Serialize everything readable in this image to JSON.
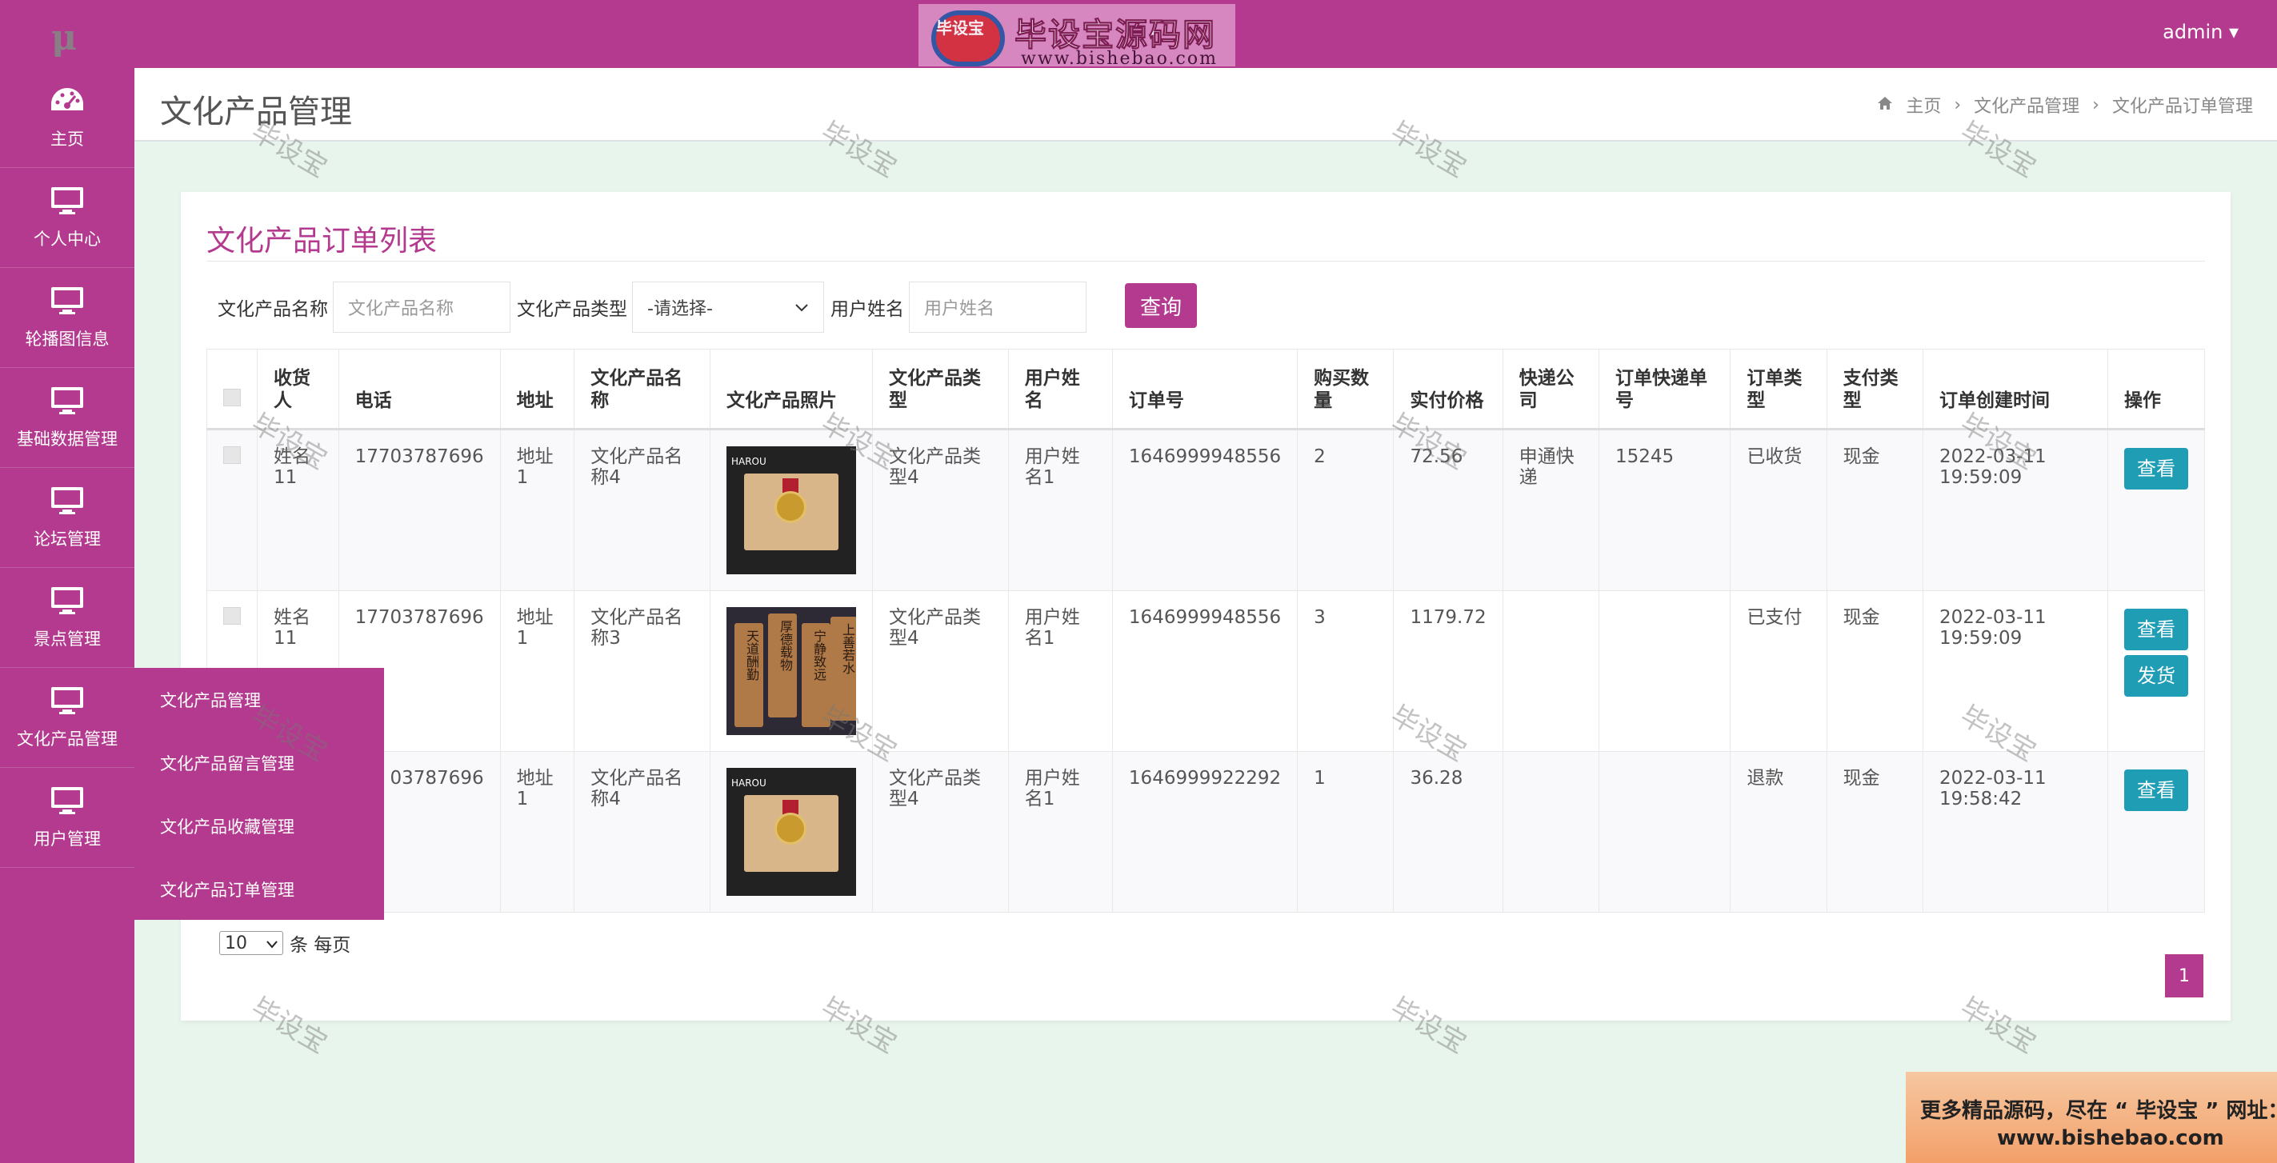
{
  "topbar": {
    "logo": "μ",
    "brand_badge": "毕设宝",
    "brand_title": "毕设宝源码网",
    "brand_url": "www.bishebao.com",
    "user": "admin ▾"
  },
  "sidebar": {
    "items": [
      {
        "label": "主页",
        "icon": "dashboard-icon"
      },
      {
        "label": "个人中心",
        "icon": "monitor-icon"
      },
      {
        "label": "轮播图信息",
        "icon": "monitor-icon"
      },
      {
        "label": "基础数据管理",
        "icon": "monitor-icon"
      },
      {
        "label": "论坛管理",
        "icon": "monitor-icon"
      },
      {
        "label": "景点管理",
        "icon": "monitor-icon"
      },
      {
        "label": "文化产品管理",
        "icon": "monitor-icon"
      },
      {
        "label": "用户管理",
        "icon": "monitor-icon"
      }
    ],
    "submenu": [
      "文化产品管理",
      "文化产品留言管理",
      "文化产品收藏管理",
      "文化产品订单管理"
    ]
  },
  "header": {
    "title": "文化产品管理",
    "breadcrumb": [
      "主页",
      "文化产品管理",
      "文化产品订单管理"
    ],
    "home_icon": "home-icon"
  },
  "card": {
    "title": "文化产品订单列表",
    "filters": {
      "name_label": "文化产品名称",
      "name_placeholder": "文化产品名称",
      "type_label": "文化产品类型",
      "type_value": "-请选择-",
      "user_label": "用户姓名",
      "user_placeholder": "用户姓名",
      "search_button": "查询"
    },
    "columns": [
      "收货人",
      "电话",
      "地址",
      "文化产品名称",
      "文化产品照片",
      "文化产品类型",
      "用户姓名",
      "订单号",
      "购买数量",
      "实付价格",
      "快递公司",
      "订单快递单号",
      "订单类型",
      "支付类型",
      "订单创建时间",
      "操作"
    ],
    "rows": [
      {
        "receiver": "姓名11",
        "phone": "17703787696",
        "address": "地址1",
        "product": "文化产品名称4",
        "photo": "medal-plaque",
        "ptype": "文化产品类型4",
        "user": "用户姓名1",
        "order_no": "1646999948556",
        "qty": "2",
        "price": "72.56",
        "courier": "申通快递",
        "tracking": "15245",
        "otype": "已收货",
        "pay": "现金",
        "created": "2022-03-11 19:59:09",
        "actions": [
          "查看"
        ]
      },
      {
        "receiver": "姓名11",
        "phone": "17703787696",
        "address": "地址1",
        "product": "文化产品名称3",
        "photo": "wood-slats",
        "ptype": "文化产品类型4",
        "user": "用户姓名1",
        "order_no": "1646999948556",
        "qty": "3",
        "price": "1179.72",
        "courier": "",
        "tracking": "",
        "otype": "已支付",
        "pay": "现金",
        "created": "2022-03-11 19:59:09",
        "actions": [
          "查看",
          "发货"
        ]
      },
      {
        "receiver": "",
        "phone": "03787696",
        "address": "地址1",
        "product": "文化产品名称4",
        "photo": "medal-plaque",
        "ptype": "文化产品类型4",
        "user": "用户姓名1",
        "order_no": "1646999922292",
        "qty": "1",
        "price": "36.28",
        "courier": "",
        "tracking": "",
        "otype": "退款",
        "pay": "现金",
        "created": "2022-03-11 19:58:42",
        "actions": [
          "查看"
        ]
      }
    ],
    "pager": {
      "per_page": "10",
      "suffix": "条 每页",
      "current_page": "1"
    }
  },
  "watermark": "毕设宝",
  "promo": {
    "line1": "更多精品源码，尽在 “ 毕设宝 ” 网址：",
    "line2": "www.bishebao.com"
  },
  "colors": {
    "primary": "#b33a8e",
    "action": "#1e9db5",
    "background": "#e8f5ec"
  }
}
